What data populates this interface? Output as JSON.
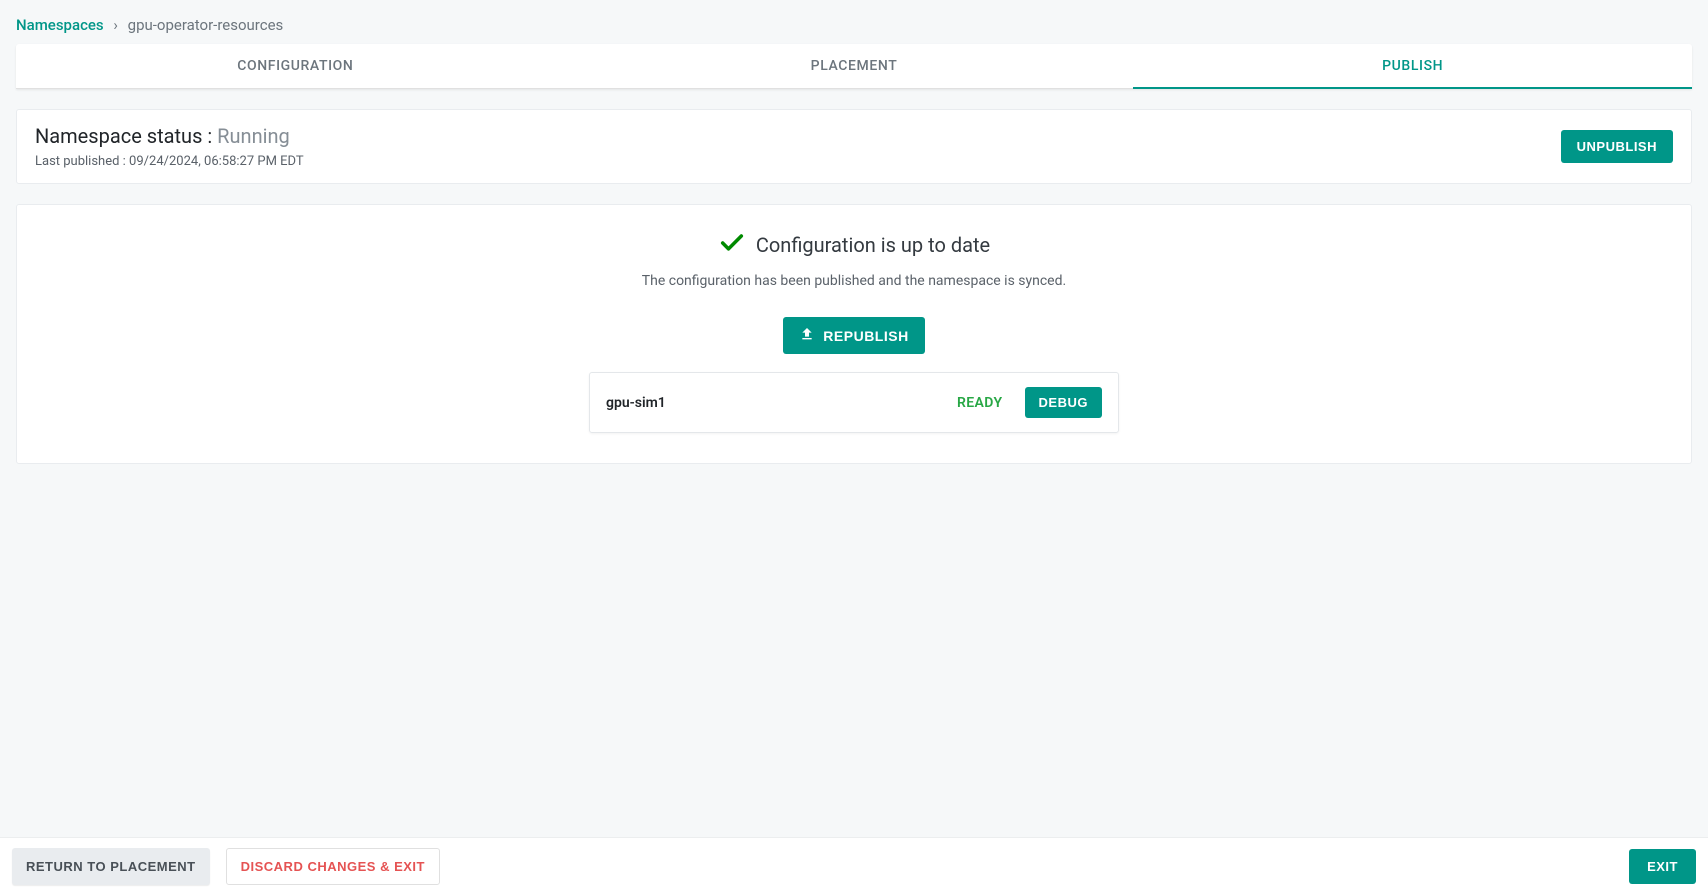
{
  "breadcrumb": {
    "root": "Namespaces",
    "separator": "›",
    "current": "gpu-operator-resources"
  },
  "tabs": {
    "configuration": "CONFIGURATION",
    "placement": "PLACEMENT",
    "publish": "PUBLISH"
  },
  "status": {
    "label": "Namespace status : ",
    "value": "Running",
    "last_published_label": "Last published : ",
    "last_published_value": "09/24/2024, 06:58:27 PM EDT",
    "unpublish": "UNPUBLISH"
  },
  "config": {
    "title": "Configuration is up to date",
    "description": "The configuration has been published and the namespace is synced.",
    "republish": "REPUBLISH"
  },
  "items": [
    {
      "name": "gpu-sim1",
      "status": "READY",
      "debug": "DEBUG"
    }
  ],
  "footer": {
    "return": "RETURN TO PLACEMENT",
    "discard": "DISCARD CHANGES & EXIT",
    "exit": "EXIT"
  },
  "icons": {
    "check": "check-icon",
    "upload": "upload-icon"
  }
}
